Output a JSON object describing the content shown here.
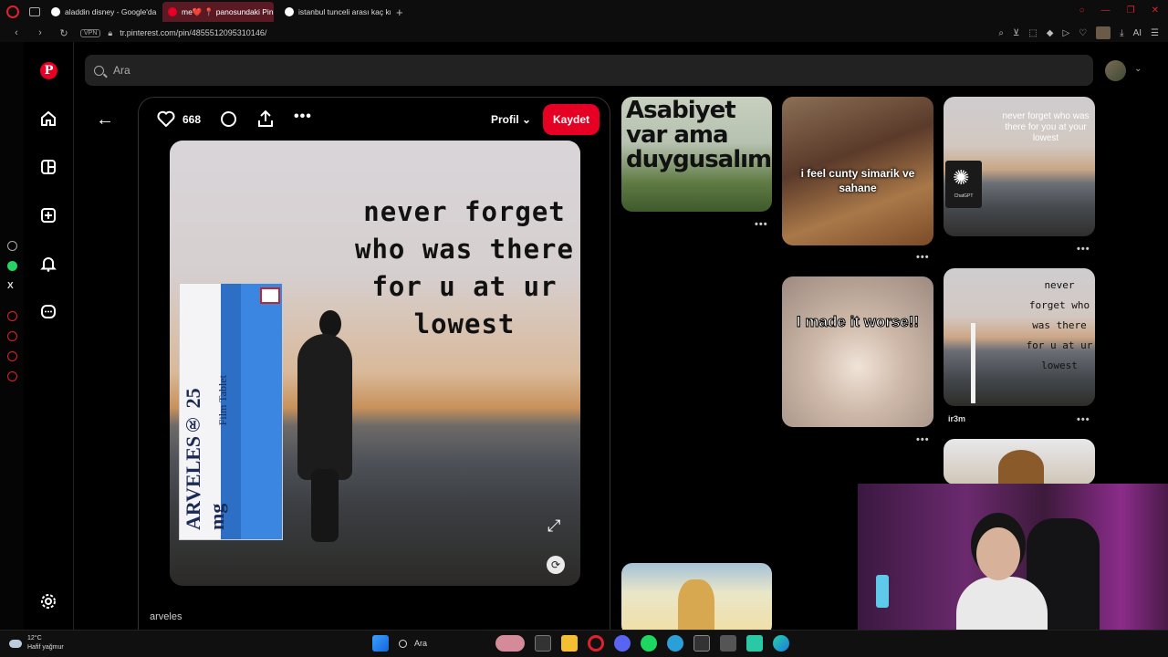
{
  "browser": {
    "tabs": [
      {
        "label": "aladdin disney - Google'da Ara",
        "active": false
      },
      {
        "label": "me❤️ 📍 panosundaki Pin",
        "active": true
      },
      {
        "label": "istanbul tunceli arası kaç km",
        "active": false
      }
    ],
    "vpn_label": "VPN",
    "url": "tr.pinterest.com/pin/4855512095310146/",
    "ai_label": "AI"
  },
  "search": {
    "placeholder": "Ara"
  },
  "pin": {
    "like_count": "668",
    "profile_label": "Profil",
    "save_label": "Kaydet",
    "image_text": "never forget who was there for u at ur lowest",
    "box_brand": "ARVELES® 25 mg",
    "box_sub": "Film Tablet",
    "author": "arveles"
  },
  "grid": {
    "p1_line1": "Asabiyet",
    "p1_line2": "var ama",
    "p1_line3": "duygusalım",
    "p2_text": "i feel cunty simarik ve sahane",
    "p3_text": "never forget who was there for you at your lowest",
    "p3_badge": "ChatGPT",
    "p4_text": "I made it worse!!",
    "p5_text": "never forget who was there for u at ur lowest",
    "p5_author": "ir3m",
    "more": "•••"
  },
  "taskbar": {
    "temperature": "12°C",
    "weather": "Hafif yağmur",
    "search_label": "Ara"
  },
  "colors": {
    "accent": "#e60023",
    "background": "#000000"
  }
}
